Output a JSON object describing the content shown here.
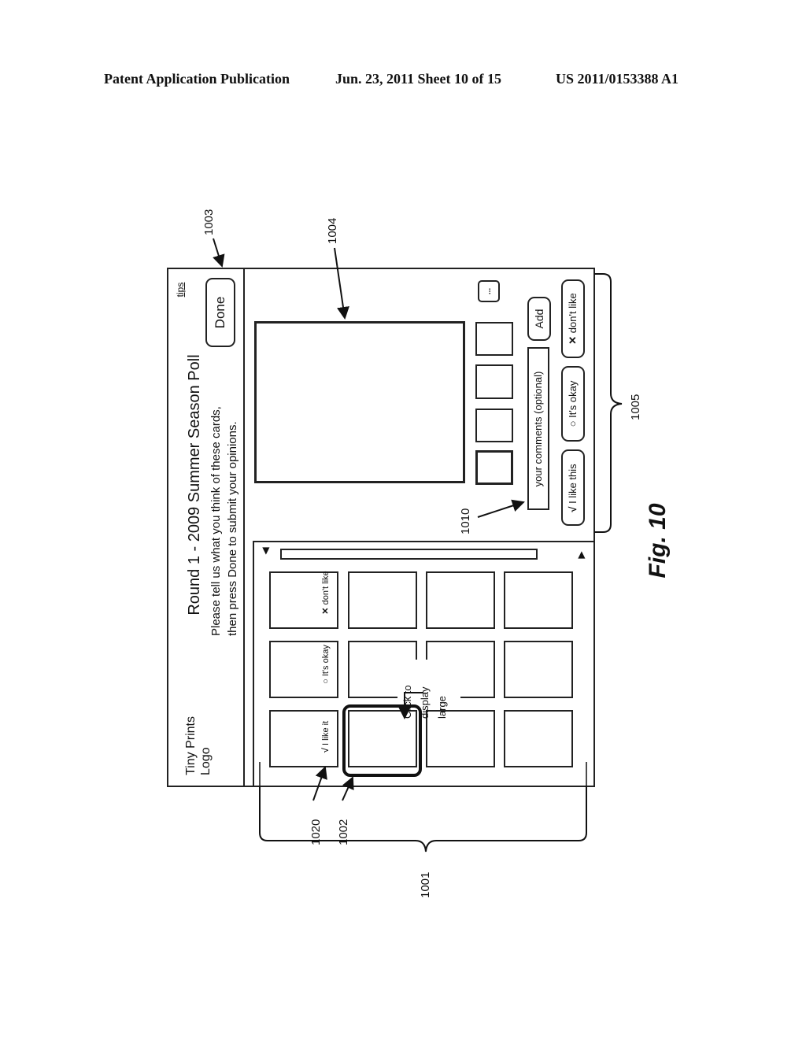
{
  "header": {
    "publication": "Patent Application Publication",
    "date_sheet": "Jun. 23, 2011  Sheet 10 of 15",
    "patent_number": "US 2011/0153388 A1"
  },
  "app": {
    "logo": [
      "Tiny Prints",
      "Logo"
    ],
    "title": "Round 1 - 2009 Summer Season Poll",
    "instructions": [
      "Please tell us what you think of these cards,",
      "then press Done to submit your opinions."
    ],
    "tips_link": "tips",
    "done_button": "Done"
  },
  "grid": {
    "rows": 3,
    "cols": 4,
    "rating_labels": [
      {
        "icon": "check-icon",
        "glyph": "√",
        "label": "I like it"
      },
      {
        "icon": "circle-icon",
        "glyph": "○",
        "label": "It's okay"
      },
      {
        "icon": "x-icon",
        "glyph": "✕",
        "label": "don't like"
      }
    ],
    "hint": [
      "Click to",
      "display",
      "large"
    ],
    "scroll_left": "◀",
    "scroll_right": "▶"
  },
  "detail": {
    "thumbnails": 4,
    "more_button": "...",
    "comment_placeholder": "your comments (optional)",
    "add_button": "Add",
    "rating_buttons": [
      {
        "icon": "check-icon",
        "glyph": "√",
        "label": "I like this"
      },
      {
        "icon": "circle-icon",
        "glyph": "○",
        "label": "It's okay"
      },
      {
        "icon": "x-icon",
        "glyph": "✕",
        "label": "don't like"
      }
    ]
  },
  "refs": {
    "r1001": "1001",
    "r1002": "1002",
    "r1003": "1003",
    "r1004": "1004",
    "r1005": "1005",
    "r1010": "1010",
    "r1020": "1020"
  },
  "figure_label": "Fig. 10"
}
